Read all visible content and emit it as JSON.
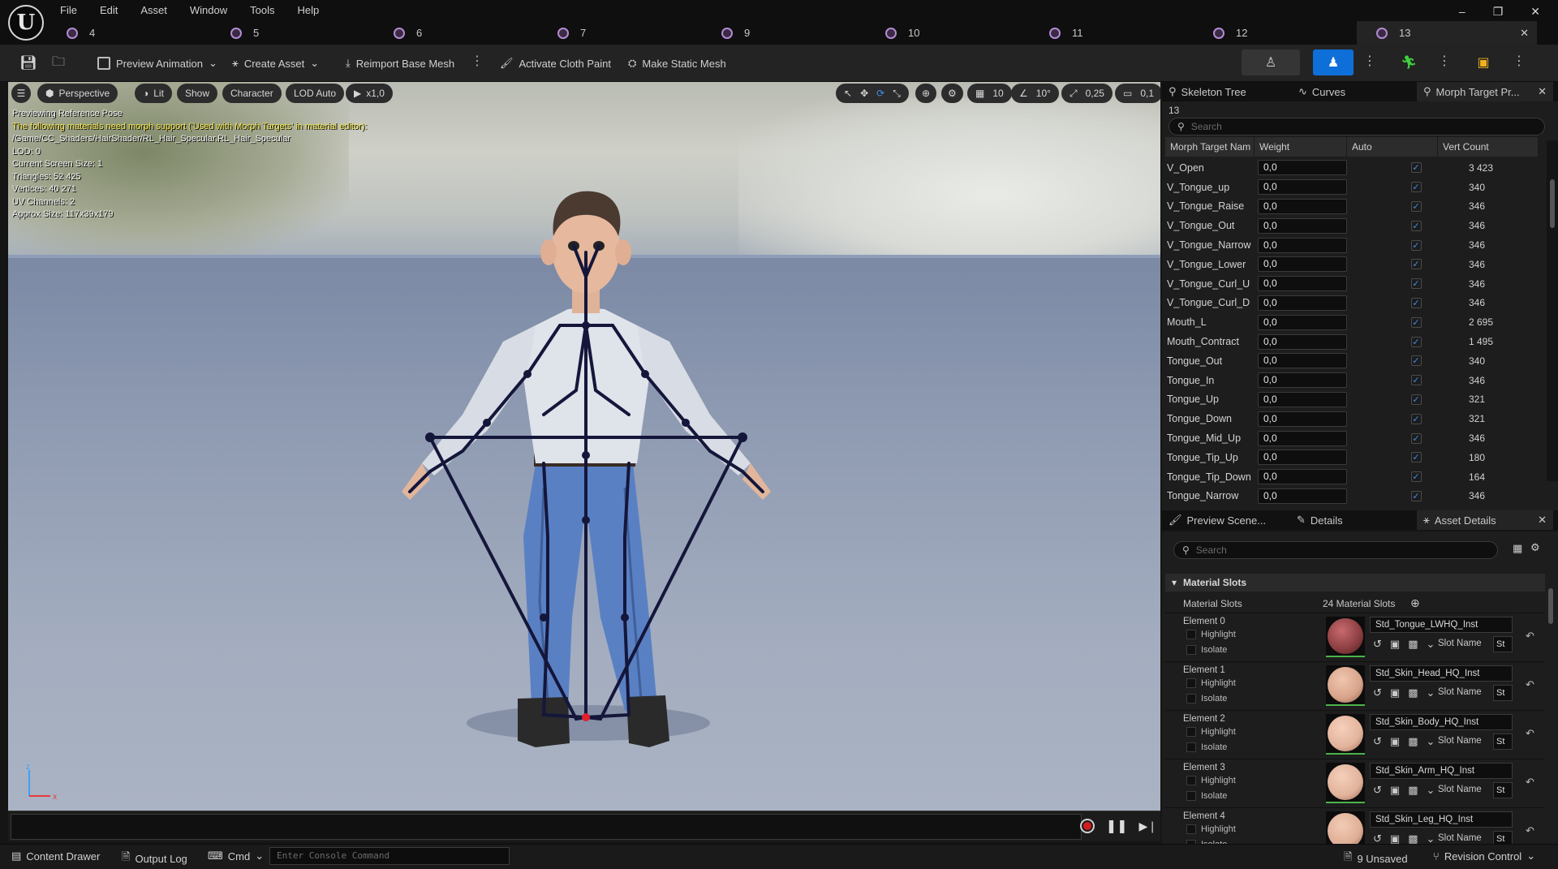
{
  "menu": [
    "File",
    "Edit",
    "Asset",
    "Window",
    "Tools",
    "Help"
  ],
  "window_controls": {
    "minimize": "–",
    "restore": "❐",
    "close": "✕"
  },
  "doc_tabs": [
    {
      "label": "4"
    },
    {
      "label": "5"
    },
    {
      "label": "6"
    },
    {
      "label": "7"
    },
    {
      "label": "9"
    },
    {
      "label": "10"
    },
    {
      "label": "11"
    },
    {
      "label": "12"
    },
    {
      "label": "13",
      "active": true
    }
  ],
  "toolbar": {
    "preview_animation": "Preview Animation",
    "create_asset": "Create Asset",
    "reimport": "Reimport Base Mesh",
    "activate_cloth": "Activate Cloth Paint",
    "make_static": "Make Static Mesh"
  },
  "viewport": {
    "perspective": "Perspective",
    "lit": "Lit",
    "show": "Show",
    "character": "Character",
    "lod": "LOD Auto",
    "play_speed": "x1,0",
    "grid_snap": "10",
    "rot_snap": "10°",
    "scale_snap": "0,25",
    "camera_speed": "0,1",
    "overlay": {
      "line1": "Previewing Reference Pose",
      "warning": "The following materials need morph support ('Used with Morph Targets' in material editor):",
      "path": "/Game/CC_Shaders/HairShader/RL_Hair_Specular.RL_Hair_Specular",
      "lod": "LOD: 0",
      "screen_size": "Current Screen Size: 1",
      "triangles": "Triangles: 52 425",
      "vertices": "Vertices: 40 271",
      "uv": "UV Channels: 2",
      "approx": "Approx Size: 117x39x179"
    }
  },
  "console": {
    "placeholder": "Enter Console Command"
  },
  "statusbar": {
    "content_drawer": "Content Drawer",
    "output_log": "Output Log",
    "cmd": "Cmd",
    "unsaved": "9 Unsaved",
    "revision": "Revision Control"
  },
  "top_panel_tabs": {
    "skeleton": "Skeleton Tree",
    "curves": "Curves",
    "morph": "Morph Target Pr..."
  },
  "morph_panel": {
    "label": "13",
    "search_placeholder": "Search",
    "headers": {
      "name": "Morph Target Nam",
      "weight": "Weight",
      "auto": "Auto",
      "vert": "Vert Count"
    },
    "rows": [
      {
        "name": "V_Open",
        "weight": "0,0",
        "vert": "3 423"
      },
      {
        "name": "V_Tongue_up",
        "weight": "0,0",
        "vert": "340"
      },
      {
        "name": "V_Tongue_Raise",
        "weight": "0,0",
        "vert": "346"
      },
      {
        "name": "V_Tongue_Out",
        "weight": "0,0",
        "vert": "346"
      },
      {
        "name": "V_Tongue_Narrow",
        "weight": "0,0",
        "vert": "346"
      },
      {
        "name": "V_Tongue_Lower",
        "weight": "0,0",
        "vert": "346"
      },
      {
        "name": "V_Tongue_Curl_U",
        "weight": "0,0",
        "vert": "346"
      },
      {
        "name": "V_Tongue_Curl_D",
        "weight": "0,0",
        "vert": "346"
      },
      {
        "name": "Mouth_L",
        "weight": "0,0",
        "vert": "2 695"
      },
      {
        "name": "Mouth_Contract",
        "weight": "0,0",
        "vert": "1 495"
      },
      {
        "name": "Tongue_Out",
        "weight": "0,0",
        "vert": "340"
      },
      {
        "name": "Tongue_In",
        "weight": "0,0",
        "vert": "346"
      },
      {
        "name": "Tongue_Up",
        "weight": "0,0",
        "vert": "321"
      },
      {
        "name": "Tongue_Down",
        "weight": "0,0",
        "vert": "321"
      },
      {
        "name": "Tongue_Mid_Up",
        "weight": "0,0",
        "vert": "346"
      },
      {
        "name": "Tongue_Tip_Up",
        "weight": "0,0",
        "vert": "180"
      },
      {
        "name": "Tongue_Tip_Down",
        "weight": "0,0",
        "vert": "164"
      },
      {
        "name": "Tongue_Narrow",
        "weight": "0,0",
        "vert": "346"
      }
    ]
  },
  "bottom_panel_tabs": {
    "preview": "Preview Scene...",
    "details": "Details",
    "asset": "Asset Details"
  },
  "asset_details": {
    "search_placeholder": "Search",
    "section": "Material Slots",
    "slots_label": "Material Slots",
    "slots_count": "24 Material Slots",
    "highlight": "Highlight",
    "isolate": "Isolate",
    "slot_name": "Slot Name",
    "slot_name_value": "St",
    "elements": [
      {
        "label": "Element 0",
        "material": "Std_Tongue_LWHQ_Inst",
        "color": "#8a3d40"
      },
      {
        "label": "Element 1",
        "material": "Std_Skin_Head_HQ_Inst",
        "color": "#d7a38a"
      },
      {
        "label": "Element 2",
        "material": "Std_Skin_Body_HQ_Inst",
        "color": "#e2b39c"
      },
      {
        "label": "Element 3",
        "material": "Std_Skin_Arm_HQ_Inst",
        "color": "#e1b29b"
      },
      {
        "label": "Element 4",
        "material": "Std_Skin_Leg_HQ_Inst",
        "color": "#dfae96"
      }
    ]
  }
}
